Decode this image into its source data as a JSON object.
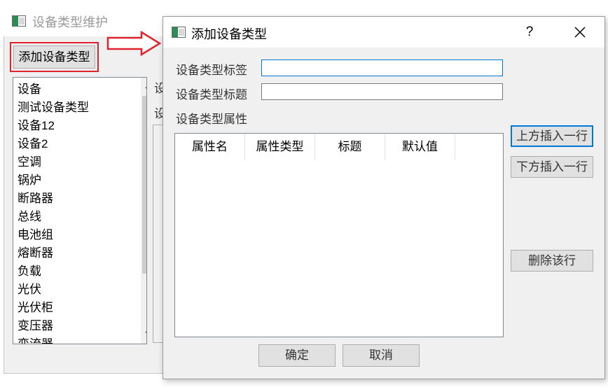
{
  "main_window": {
    "title": "设备类型维护",
    "add_button_label": "添加设备类型",
    "device_list": [
      "设备",
      "测试设备类型",
      "设备12",
      "设备2",
      "空调",
      "锅炉",
      "断路器",
      "总线",
      "电池组",
      "熔断器",
      "负载",
      "光伏",
      "光伏柜",
      "变压器",
      "变流器"
    ],
    "scroll_up_glyph": "^",
    "scroll_down_glyph": "v",
    "partial_label_1": "设",
    "partial_label_2": "设"
  },
  "dialog": {
    "title": "添加设备类型",
    "help_label": "?",
    "close_label": "✕",
    "tag_label": "设备类型标签",
    "tag_value": "",
    "title_label": "设备类型标题",
    "title_value": "",
    "attributes_label": "设备类型属性",
    "table_headers": [
      "属性名",
      "属性类型",
      "标题",
      "默认值"
    ],
    "insert_above_label": "上方插入一行",
    "insert_below_label": "下方插入一行",
    "delete_row_label": "删除该行",
    "ok_label": "确定",
    "cancel_label": "取消"
  },
  "colors": {
    "highlight_red": "#e0242d",
    "focus_blue": "#0078d7"
  }
}
